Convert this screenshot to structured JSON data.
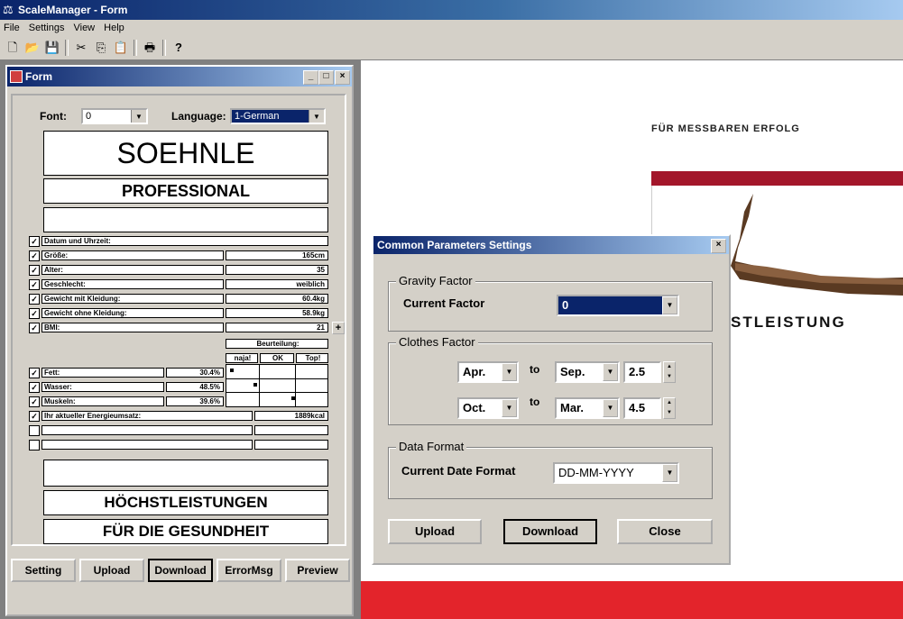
{
  "app": {
    "title": "ScaleManager - Form"
  },
  "menu": [
    "File",
    "Settings",
    "View",
    "Help"
  ],
  "toolbar_icons": [
    "new-icon",
    "open-icon",
    "save-icon",
    "cut-icon",
    "copy-icon",
    "paste-icon",
    "print-icon",
    "help-icon"
  ],
  "form": {
    "title": "Form",
    "font_label": "Font:",
    "font_value": "0",
    "language_label": "Language:",
    "language_value": "1-German",
    "header1": "SOEHNLE",
    "header2": "PROFESSIONAL",
    "rows": [
      {
        "label": "Datum und Uhrzeit:",
        "value": "",
        "checked": true
      },
      {
        "label": "Größe:",
        "value": "165cm",
        "checked": true
      },
      {
        "label": "Alter:",
        "value": "35",
        "checked": true
      },
      {
        "label": "Geschlecht:",
        "value": "weiblich",
        "checked": true
      },
      {
        "label": "Gewicht mit Kleidung:",
        "value": "60.4kg",
        "checked": true
      },
      {
        "label": "Gewicht ohne Kleidung:",
        "value": "58.9kg",
        "checked": true
      },
      {
        "label": "BMI:",
        "value": "21",
        "checked": true
      }
    ],
    "bmi_plus": "+",
    "assessment": {
      "title": "Beurteilung:",
      "cols": [
        "naja!",
        "OK",
        "Top!"
      ]
    },
    "body_rows": [
      {
        "label": "Fett:",
        "value": "30.4%",
        "checked": true
      },
      {
        "label": "Wasser:",
        "value": "48.5%",
        "checked": true
      },
      {
        "label": "Muskeln:",
        "value": "39.6%",
        "checked": true
      }
    ],
    "energy": {
      "label": "Ihr aktueller Energieumsatz:",
      "value": "1889kcal",
      "checked": true
    },
    "footer1": "HÖCHSTLEISTUNGEN",
    "footer2": "FÜR DIE GESUNDHEIT",
    "buttons": [
      "Setting",
      "Upload",
      "Download",
      "ErrorMsg",
      "Preview"
    ]
  },
  "background": {
    "tagline": "FÜR MESSBAREN ERFOLG",
    "caption": "STLEISTUNG",
    "colors": {
      "dark_red": "#a3162a",
      "red": "#e3242b"
    }
  },
  "dialog": {
    "title": "Common Parameters Settings",
    "gravity": {
      "group": "Gravity Factor",
      "label": "Current Factor",
      "value": "0"
    },
    "clothes": {
      "group": "Clothes Factor",
      "row1": {
        "from": "Apr.",
        "to_label": "to",
        "to": "Sep.",
        "factor": "2.5"
      },
      "row2": {
        "from": "Oct.",
        "to_label": "to",
        "to": "Mar.",
        "factor": "4.5"
      }
    },
    "format": {
      "group": "Data Format",
      "label": "Current Date Format",
      "value": "DD-MM-YYYY"
    },
    "buttons": {
      "upload": "Upload",
      "download": "Download",
      "close": "Close"
    }
  }
}
